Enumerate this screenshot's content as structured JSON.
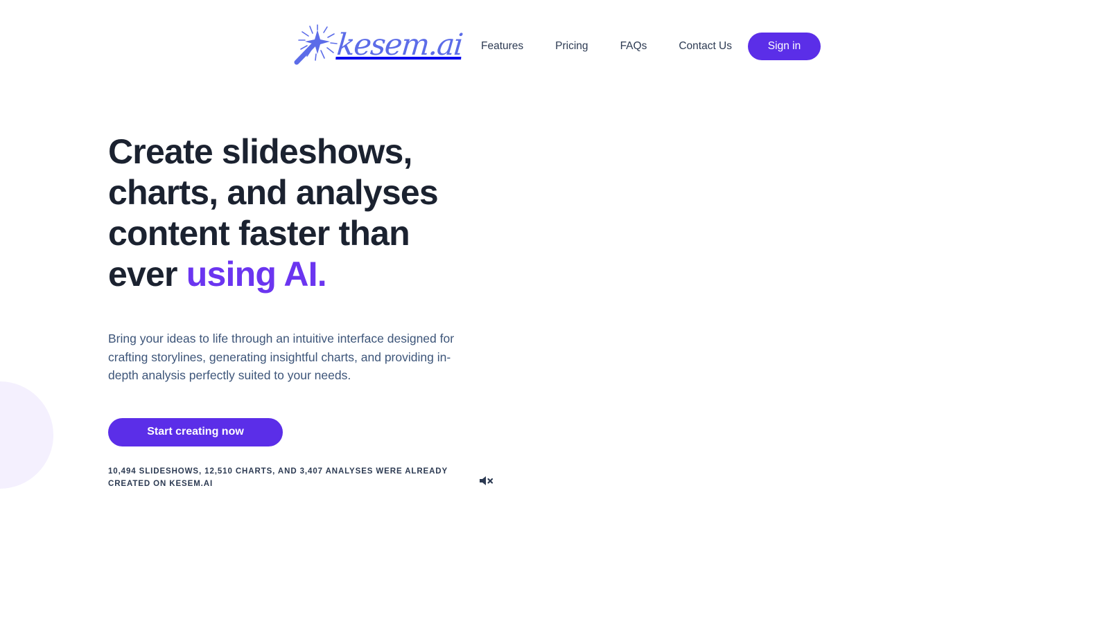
{
  "brand": {
    "name": "kesem.ai",
    "logo_icon": "magic-wand-sparkle-icon",
    "logo_color": "#5c6ce8"
  },
  "colors": {
    "accent_purple": "#6b35f0",
    "button_purple": "#5b2ee8",
    "headline": "#1b2230",
    "body_text": "#3d5579",
    "stats_text": "#2c3a52",
    "decorative_circle": "#f4f0fe",
    "background": "#ffffff"
  },
  "header": {
    "nav": [
      {
        "label": "Features"
      },
      {
        "label": "Pricing"
      },
      {
        "label": "FAQs"
      },
      {
        "label": "Contact Us"
      }
    ],
    "signin_label": "Sign in"
  },
  "hero": {
    "headline_part1": "Create slideshows, charts, and analyses content faster than ever ",
    "headline_accent": "using AI.",
    "subtext": "Bring your ideas to life through an intuitive interface designed for crafting storylines, generating insightful charts, and providing in-depth analysis perfectly suited to your needs.",
    "cta_label": "Start creating now",
    "stats": "10,494 SLIDESHOWS, 12,510 CHARTS, AND 3,407 ANALYSES WERE ALREADY CREATED ON KESEM.AI",
    "mute_icon": "speaker-mute-icon"
  }
}
